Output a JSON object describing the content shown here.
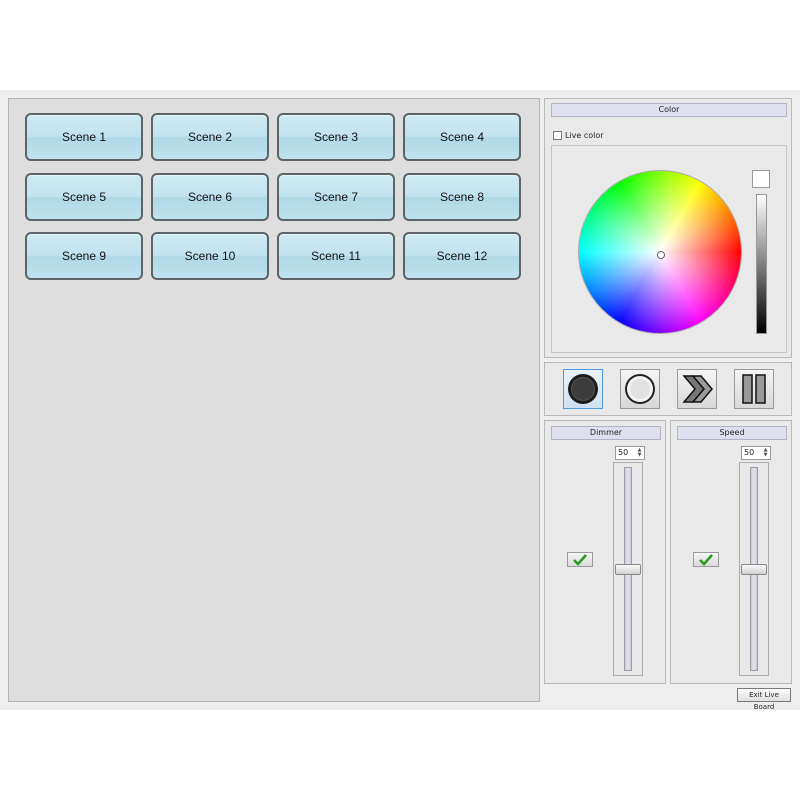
{
  "scenes": [
    "Scene 1",
    "Scene 2",
    "Scene 3",
    "Scene 4",
    "Scene 5",
    "Scene 6",
    "Scene 7",
    "Scene 8",
    "Scene 9",
    "Scene 10",
    "Scene 11",
    "Scene 12"
  ],
  "color_panel": {
    "title": "Color",
    "live_color_label": "Live color",
    "live_color_checked": false,
    "value_swatch": "#ffffff"
  },
  "transport": {
    "record_icon": "record-icon",
    "stop_icon": "stop-icon",
    "forward_icon": "fast-forward-icon",
    "pause_icon": "pause-icon",
    "active": "record"
  },
  "dimmer": {
    "title": "Dimmer",
    "value": "50",
    "enabled": true
  },
  "speed": {
    "title": "Speed",
    "value": "50",
    "enabled": true
  },
  "exit_label": "Exit Live Board",
  "colors": {
    "scene_button": "#c1e3ef",
    "panel_title": "#dfe0ee",
    "active_border": "#4f9ae0"
  }
}
